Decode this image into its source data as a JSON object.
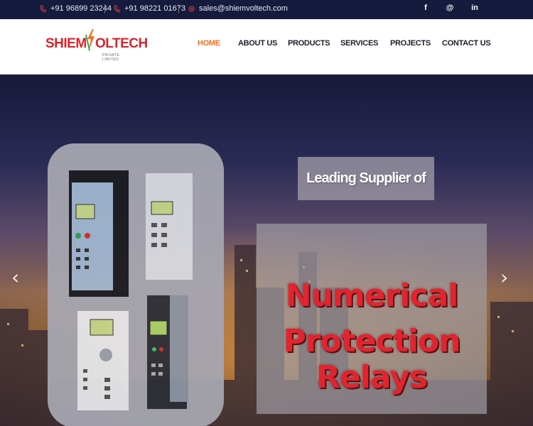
{
  "topbar": {
    "phone1": "+91 96899 23244",
    "phone2": "+91 98221 01673",
    "email": "sales@shiemvoltech.com",
    "social": [
      "f",
      "@",
      "in"
    ]
  },
  "logo": {
    "left_text": "SHIEM",
    "right_text": "OLTECH",
    "sub_text": "PRIVATE LIMITED"
  },
  "nav": [
    "HOME",
    "ABOUT US",
    "PRODUCTS",
    "SERVICES",
    "PROJECTS",
    "CONTACT US"
  ],
  "hero": {
    "tagline": "Leading Supplier of",
    "headline_line1": "Numerical",
    "headline_line2": "Protection Relays",
    "prev_arrow": "‹",
    "next_arrow": "›"
  },
  "colors": {
    "topbar_bg": "#151b3d",
    "accent": "#f36f21",
    "brand_red": "#d8242b",
    "brand_green": "#2aa84a"
  }
}
